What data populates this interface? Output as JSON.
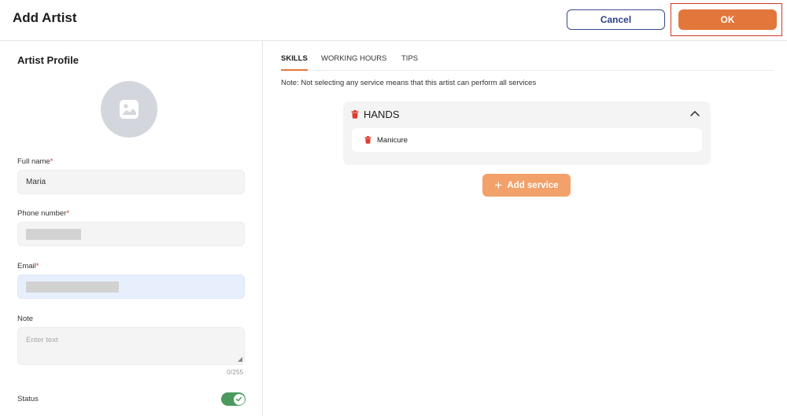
{
  "header": {
    "title": "Add Artist",
    "cancel_label": "Cancel",
    "ok_label": "OK"
  },
  "profile": {
    "section_title": "Artist Profile",
    "full_name_label": "Full name",
    "full_name_value": "Maria",
    "phone_label": "Phone number",
    "email_label": "Email",
    "note_label": "Note",
    "note_placeholder": "Enter text",
    "note_counter": "0/255",
    "status_label": "Status",
    "required_mark": "*",
    "status_on": true
  },
  "tabs": [
    {
      "label": "SKILLS",
      "active": true
    },
    {
      "label": "WORKING HOURS",
      "active": false
    },
    {
      "label": "TIPS",
      "active": false
    }
  ],
  "skills": {
    "note": "Note: Not selecting any service means that this artist can perform all services",
    "groups": [
      {
        "name": "HANDS",
        "expanded": true,
        "services": [
          {
            "name": "Manicure"
          }
        ]
      }
    ],
    "add_service_label": "Add service",
    "add_icon": "plus-icon"
  },
  "colors": {
    "accent": "#e3773b",
    "accent_light": "#f2a16a",
    "danger": "#e03b2e",
    "toggle_on": "#4a9a5e",
    "primary_outline": "#3a4a8c"
  }
}
